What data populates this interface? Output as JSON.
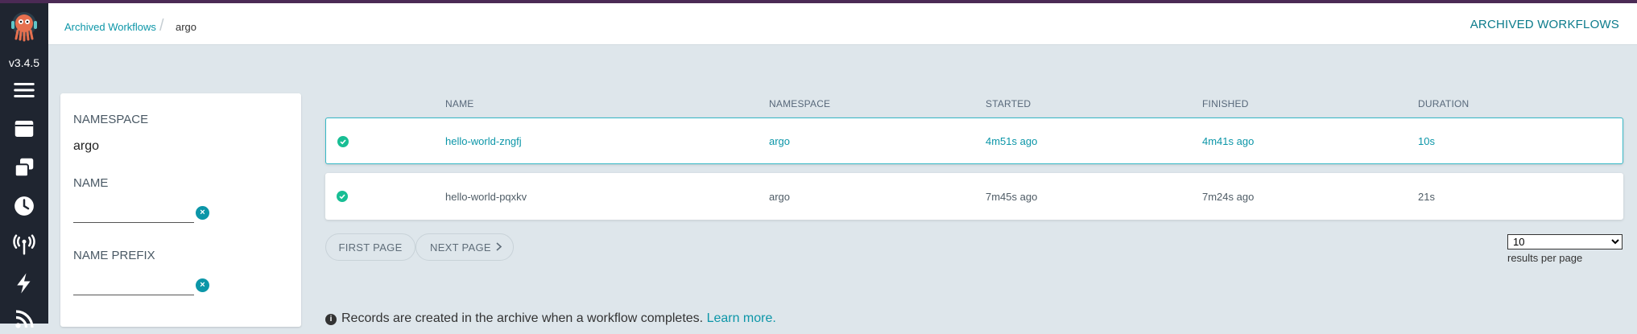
{
  "app": {
    "version": "v3.4.5"
  },
  "colors": {
    "accent": "#0c96a8",
    "nav_bg": "#1f2530",
    "success": "#18be94",
    "page_bg": "#dee6eb"
  },
  "nav": {
    "items": [
      {
        "icon": "hamburger-icon"
      },
      {
        "icon": "workflows-icon"
      },
      {
        "icon": "workflow-templates-icon"
      },
      {
        "icon": "cron-workflows-icon"
      },
      {
        "icon": "event-sources-icon"
      },
      {
        "icon": "sensors-icon"
      },
      {
        "icon": "feed-icon"
      }
    ]
  },
  "breadcrumb": {
    "parent": "Archived Workflows",
    "current": "argo"
  },
  "header": {
    "title": "ARCHIVED WORKFLOWS"
  },
  "filters": {
    "namespace_label": "NAMESPACE",
    "namespace_value": "argo",
    "name_label": "NAME",
    "name_value": "",
    "name_prefix_label": "NAME PREFIX",
    "name_prefix_value": ""
  },
  "table": {
    "columns": [
      "NAME",
      "NAMESPACE",
      "STARTED",
      "FINISHED",
      "DURATION"
    ],
    "rows": [
      {
        "status": "succeeded",
        "name": "hello-world-zngfj",
        "namespace": "argo",
        "started": "4m51s ago",
        "finished": "4m41s ago",
        "duration": "10s"
      },
      {
        "status": "succeeded",
        "name": "hello-world-pqxkv",
        "namespace": "argo",
        "started": "7m45s ago",
        "finished": "7m24s ago",
        "duration": "21s"
      }
    ]
  },
  "pagination": {
    "first_page": "FIRST PAGE",
    "next_page": "NEXT PAGE",
    "per_page_value": "10",
    "per_page_label": "results per page"
  },
  "info": {
    "text": "Records are created in the archive when a workflow completes.",
    "link": "Learn more."
  }
}
